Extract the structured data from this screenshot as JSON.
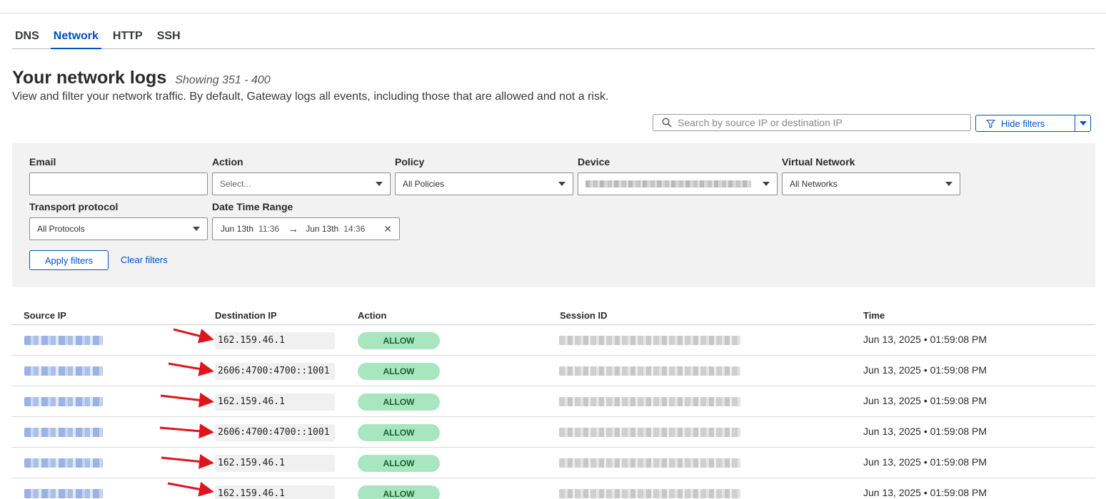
{
  "tabs": [
    {
      "label": "DNS",
      "active": false
    },
    {
      "label": "Network",
      "active": true
    },
    {
      "label": "HTTP",
      "active": false
    },
    {
      "label": "SSH",
      "active": false
    }
  ],
  "header": {
    "title": "Your network logs",
    "showing": "Showing 351 - 400",
    "subtitle": "View and filter your network traffic. By default, Gateway logs all events, including those that are allowed and not a risk."
  },
  "search": {
    "placeholder": "Search by source IP or destination IP",
    "icon": "search-icon"
  },
  "hide_filters": {
    "label": "Hide filters",
    "icon": "filter-icon"
  },
  "filters": {
    "email": {
      "label": "Email",
      "value": ""
    },
    "action": {
      "label": "Action",
      "value": "Select..."
    },
    "policy": {
      "label": "Policy",
      "value": "All Policies"
    },
    "device": {
      "label": "Device",
      "value": ""
    },
    "virtual_network": {
      "label": "Virtual Network",
      "value": "All Networks"
    },
    "transport_protocol": {
      "label": "Transport protocol",
      "value": "All Protocols"
    },
    "date_time_range": {
      "label": "Date Time Range",
      "start_date": "Jun 13th",
      "start_time": "11:36",
      "end_date": "Jun 13th",
      "end_time": "14:36"
    },
    "apply_label": "Apply filters",
    "clear_label": "Clear filters"
  },
  "table": {
    "columns": [
      "Source IP",
      "Destination IP",
      "Action",
      "Session ID",
      "Time"
    ],
    "rows": [
      {
        "destination_ip": "162.159.46.1",
        "action": "ALLOW",
        "time": "Jun 13, 2025 • 01:59:08 PM"
      },
      {
        "destination_ip": "2606:4700:4700::1001",
        "action": "ALLOW",
        "time": "Jun 13, 2025 • 01:59:08 PM"
      },
      {
        "destination_ip": "162.159.46.1",
        "action": "ALLOW",
        "time": "Jun 13, 2025 • 01:59:08 PM"
      },
      {
        "destination_ip": "2606:4700:4700::1001",
        "action": "ALLOW",
        "time": "Jun 13, 2025 • 01:59:08 PM"
      },
      {
        "destination_ip": "162.159.46.1",
        "action": "ALLOW",
        "time": "Jun 13, 2025 • 01:59:08 PM"
      },
      {
        "destination_ip": "162.159.46.1",
        "action": "ALLOW",
        "time": "Jun 13, 2025 • 01:59:08 PM"
      }
    ]
  },
  "colors": {
    "accent": "#0051c3",
    "allow_badge_bg": "#a8e6bf",
    "allow_badge_text": "#16622f",
    "annotation_arrow": "#e0141e",
    "filter_panel_bg": "#f2f2f2"
  }
}
